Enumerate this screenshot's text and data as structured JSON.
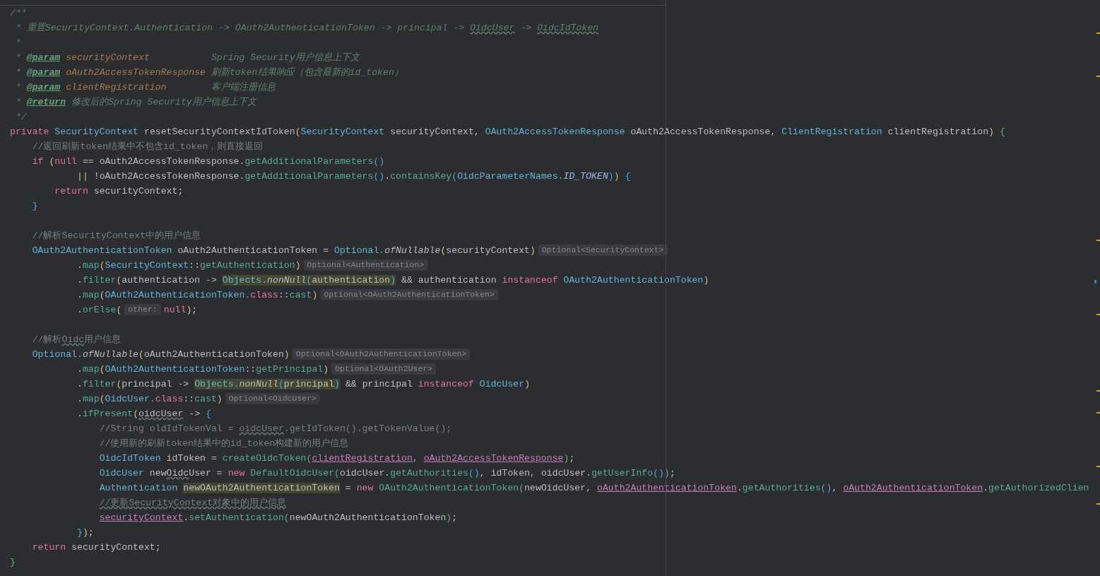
{
  "editor": {
    "blocks": [
      {
        "lines": [
          {
            "tokens": [
              {
                "text": "/**",
                "kind": "doc"
              }
            ]
          },
          {
            "tokens": [
              {
                "text": " * 重置SecurityContext.Authentication -> OAuth2AuthenticationToken -> principal -> ",
                "kind": "doc"
              },
              {
                "text": "OidcUser",
                "kind": "doc-typo"
              },
              {
                "text": " -> ",
                "kind": "doc"
              },
              {
                "text": "OidcIdToken",
                "kind": "doc-typo"
              }
            ]
          },
          {
            "tokens": [
              {
                "text": " *",
                "kind": "doc"
              }
            ]
          },
          {
            "tokens": [
              {
                "text": " * ",
                "kind": "doc"
              },
              {
                "text": "@param",
                "kind": "doc-tag"
              },
              {
                "text": " securityContext",
                "kind": "doc-param"
              },
              {
                "text": "           Spring Security用户信息上下文",
                "kind": "doc"
              }
            ]
          },
          {
            "tokens": [
              {
                "text": " * ",
                "kind": "doc"
              },
              {
                "text": "@param",
                "kind": "doc-tag"
              },
              {
                "text": " oAuth2AccessTokenResponse",
                "kind": "doc-param"
              },
              {
                "text": " 刷新token结果响应（包含最新的id_token）",
                "kind": "doc"
              }
            ]
          },
          {
            "tokens": [
              {
                "text": " * ",
                "kind": "doc"
              },
              {
                "text": "@param",
                "kind": "doc-tag"
              },
              {
                "text": " clientRegistration",
                "kind": "doc-param"
              },
              {
                "text": "        客户端注册信息",
                "kind": "doc"
              }
            ]
          },
          {
            "tokens": [
              {
                "text": " * ",
                "kind": "doc"
              },
              {
                "text": "@return",
                "kind": "doc-tag"
              },
              {
                "text": " 修改后的Spring Security用户信息上下文",
                "kind": "doc"
              }
            ]
          },
          {
            "tokens": [
              {
                "text": " */",
                "kind": "doc"
              }
            ]
          },
          {
            "tokens": [
              {
                "text": "private",
                "kind": "keyword"
              },
              {
                "text": " SecurityContext",
                "kind": "type"
              },
              {
                "text": " resetSecurityContextIdToken",
                "kind": "plain"
              },
              {
                "text": "(",
                "kind": "bracket-1"
              },
              {
                "text": "SecurityContext",
                "kind": "type"
              },
              {
                "text": " securityContext, ",
                "kind": "plain"
              },
              {
                "text": "OAuth2AccessTokenResponse",
                "kind": "type"
              },
              {
                "text": " oAuth2AccessTokenResponse, ",
                "kind": "plain"
              },
              {
                "text": "ClientRegistration",
                "kind": "type"
              },
              {
                "text": " clientRegistration",
                "kind": "plain"
              },
              {
                "text": ")",
                "kind": "bracket-1"
              },
              {
                "text": " {",
                "kind": "bracket-3"
              }
            ]
          },
          {
            "tokens": [
              {
                "text": "    //返回刷新token结果中不包含id_token，则直接返回",
                "kind": "comment"
              }
            ]
          },
          {
            "tokens": [
              {
                "text": "    if",
                "kind": "keyword"
              },
              {
                "text": " (",
                "kind": "bracket-1"
              },
              {
                "text": "null",
                "kind": "keyword"
              },
              {
                "text": " == oAuth2AccessTokenResponse.",
                "kind": "plain"
              },
              {
                "text": "getAdditionalParameters",
                "kind": "method"
              },
              {
                "text": "()",
                "kind": "bracket-2"
              }
            ]
          },
          {
            "tokens": [
              {
                "text": "            ||",
                "kind": "bracket-1"
              },
              {
                "text": " !oAuth2AccessTokenResponse.",
                "kind": "plain"
              },
              {
                "text": "getAdditionalParameters",
                "kind": "method"
              },
              {
                "text": "()",
                "kind": "bracket-2"
              },
              {
                "text": ".",
                "kind": "plain"
              },
              {
                "text": "containsKey",
                "kind": "method"
              },
              {
                "text": "(",
                "kind": "bracket-2"
              },
              {
                "text": "OidcParameterNames.",
                "kind": "type"
              },
              {
                "text": "ID_TOKEN",
                "kind": "constant"
              },
              {
                "text": ")",
                "kind": "bracket-2"
              },
              {
                "text": ")",
                "kind": "bracket-1"
              },
              {
                "text": " {",
                "kind": "bracket-2"
              }
            ]
          },
          {
            "tokens": [
              {
                "text": "        return",
                "kind": "keyword"
              },
              {
                "text": " securityContext;",
                "kind": "plain"
              }
            ]
          },
          {
            "tokens": [
              {
                "text": "    }",
                "kind": "bracket-2"
              }
            ]
          }
        ]
      },
      {
        "lines": [
          {
            "tokens": [
              {
                "text": "    //解析SecurityContext中的用户信息",
                "kind": "comment"
              }
            ]
          },
          {
            "tokens": [
              {
                "text": "    OAuth2AuthenticationToken",
                "kind": "type"
              },
              {
                "text": " oAuth2AuthenticationToken = ",
                "kind": "plain"
              },
              {
                "text": "Optional.",
                "kind": "type"
              },
              {
                "text": "ofNullable",
                "kind": "static"
              },
              {
                "text": "(",
                "kind": "bracket-1"
              },
              {
                "text": "securityContext",
                "kind": "plain"
              },
              {
                "text": ")",
                "kind": "bracket-1"
              },
              {
                "text": "Optional<SecurityContext>",
                "kind": "hint"
              }
            ]
          },
          {
            "tokens": [
              {
                "text": "            .",
                "kind": "plain"
              },
              {
                "text": "map",
                "kind": "method"
              },
              {
                "text": "(",
                "kind": "bracket-1"
              },
              {
                "text": "SecurityContext",
                "kind": "type"
              },
              {
                "text": "::",
                "kind": "plain"
              },
              {
                "text": "getAuthentication",
                "kind": "method"
              },
              {
                "text": ")",
                "kind": "bracket-1"
              },
              {
                "text": "Optional<Authentication>",
                "kind": "hint"
              }
            ]
          },
          {
            "tokens": [
              {
                "text": "            .",
                "kind": "plain"
              },
              {
                "text": "filter",
                "kind": "method"
              },
              {
                "text": "(",
                "kind": "bracket-1"
              },
              {
                "text": "authentication -> ",
                "kind": "plain"
              },
              {
                "kind": "highlight",
                "tokens": [
                  {
                    "text": "Objects.",
                    "kind": "type"
                  },
                  {
                    "text": "nonNull",
                    "kind": "static"
                  },
                  {
                    "text": "(",
                    "kind": "bracket-2"
                  },
                  {
                    "text": "authentication",
                    "kind": "plain"
                  },
                  {
                    "text": ")",
                    "kind": "bracket-2"
                  }
                ]
              },
              {
                "text": " && authentication ",
                "kind": "plain"
              },
              {
                "text": "instanceof",
                "kind": "keyword"
              },
              {
                "text": " OAuth2AuthenticationToken",
                "kind": "type"
              },
              {
                "text": ")",
                "kind": "bracket-1"
              }
            ]
          },
          {
            "tokens": [
              {
                "text": "            .",
                "kind": "plain"
              },
              {
                "text": "map",
                "kind": "method"
              },
              {
                "text": "(",
                "kind": "bracket-1"
              },
              {
                "text": "OAuth2AuthenticationToken.",
                "kind": "type"
              },
              {
                "text": "class",
                "kind": "keyword"
              },
              {
                "text": "::",
                "kind": "plain"
              },
              {
                "text": "cast",
                "kind": "method"
              },
              {
                "text": ")",
                "kind": "bracket-1"
              },
              {
                "text": "Optional<OAuth2AuthenticationToken>",
                "kind": "hint"
              }
            ]
          },
          {
            "tokens": [
              {
                "text": "            .",
                "kind": "plain"
              },
              {
                "text": "orElse",
                "kind": "method"
              },
              {
                "text": "(",
                "kind": "bracket-1"
              },
              {
                "text": "other:",
                "kind": "hint"
              },
              {
                "text": "null",
                "kind": "keyword"
              },
              {
                "text": ")",
                "kind": "bracket-1"
              },
              {
                "text": ";",
                "kind": "plain"
              }
            ]
          }
        ]
      },
      {
        "lines": [
          {
            "tokens": [
              {
                "text": "    //解析",
                "kind": "comment"
              },
              {
                "text": "Oidc",
                "kind": "comment-typo"
              },
              {
                "text": "用户信息",
                "kind": "comment"
              }
            ]
          },
          {
            "tokens": [
              {
                "text": "    Optional.",
                "kind": "type"
              },
              {
                "text": "ofNullable",
                "kind": "static"
              },
              {
                "text": "(",
                "kind": "bracket-1"
              },
              {
                "text": "oAuth2AuthenticationToken",
                "kind": "plain"
              },
              {
                "text": ")",
                "kind": "bracket-1"
              },
              {
                "text": "Optional<OAuth2AuthenticationToken>",
                "kind": "hint"
              }
            ]
          },
          {
            "tokens": [
              {
                "text": "            .",
                "kind": "plain"
              },
              {
                "text": "map",
                "kind": "method"
              },
              {
                "text": "(",
                "kind": "bracket-1"
              },
              {
                "text": "OAuth2AuthenticationToken",
                "kind": "type"
              },
              {
                "text": "::",
                "kind": "plain"
              },
              {
                "text": "getPrincipal",
                "kind": "method"
              },
              {
                "text": ")",
                "kind": "bracket-1"
              },
              {
                "text": "Optional<OAuth2User>",
                "kind": "hint"
              }
            ]
          },
          {
            "tokens": [
              {
                "text": "            .",
                "kind": "plain"
              },
              {
                "text": "filter",
                "kind": "method"
              },
              {
                "text": "(",
                "kind": "bracket-1"
              },
              {
                "text": "principal -> ",
                "kind": "plain"
              },
              {
                "kind": "highlight",
                "tokens": [
                  {
                    "text": "Objects.",
                    "kind": "type"
                  },
                  {
                    "text": "nonNull",
                    "kind": "static"
                  },
                  {
                    "text": "(",
                    "kind": "bracket-2"
                  },
                  {
                    "text": "principal",
                    "kind": "plain"
                  },
                  {
                    "text": ")",
                    "kind": "bracket-2"
                  }
                ]
              },
              {
                "text": " && principal ",
                "kind": "plain"
              },
              {
                "text": "instanceof",
                "kind": "keyword"
              },
              {
                "text": " OidcUser",
                "kind": "type"
              },
              {
                "text": ")",
                "kind": "bracket-1"
              }
            ]
          },
          {
            "tokens": [
              {
                "text": "            .",
                "kind": "plain"
              },
              {
                "text": "map",
                "kind": "method"
              },
              {
                "text": "(",
                "kind": "bracket-1"
              },
              {
                "text": "OidcUser.",
                "kind": "type"
              },
              {
                "text": "class",
                "kind": "keyword"
              },
              {
                "text": "::",
                "kind": "plain"
              },
              {
                "text": "cast",
                "kind": "method"
              },
              {
                "text": ")",
                "kind": "bracket-1"
              },
              {
                "text": "Optional<OidcUser>",
                "kind": "hint"
              }
            ]
          },
          {
            "tokens": [
              {
                "text": "            .",
                "kind": "plain"
              },
              {
                "text": "ifPresent",
                "kind": "method"
              },
              {
                "text": "(",
                "kind": "bracket-1"
              },
              {
                "text": "oidcUser",
                "kind": "typo"
              },
              {
                "text": " -> ",
                "kind": "plain"
              },
              {
                "text": "{",
                "kind": "bracket-2"
              }
            ]
          },
          {
            "tokens": [
              {
                "text": "                //String oldIdTokenVal = ",
                "kind": "comment"
              },
              {
                "text": "oidcUser",
                "kind": "comment-typo"
              },
              {
                "text": ".getIdToken().getTokenValue();",
                "kind": "comment"
              }
            ]
          },
          {
            "tokens": [
              {
                "text": "                //使用新的刷新token结果中的id_token构建新的用户信息",
                "kind": "comment"
              }
            ]
          },
          {
            "tokens": [
              {
                "text": "                OidcIdToken",
                "kind": "type"
              },
              {
                "text": " idToken = ",
                "kind": "plain"
              },
              {
                "text": "createOidcToken",
                "kind": "method"
              },
              {
                "text": "(",
                "kind": "bracket-3"
              },
              {
                "text": "clientRegistration",
                "kind": "captured"
              },
              {
                "text": ", ",
                "kind": "plain"
              },
              {
                "text": "oAuth2AccessTokenResponse",
                "kind": "captured"
              },
              {
                "text": ")",
                "kind": "bracket-3"
              },
              {
                "text": ";",
                "kind": "plain"
              }
            ]
          },
          {
            "tokens": [
              {
                "text": "                OidcUser",
                "kind": "type"
              },
              {
                "text": " new",
                "kind": "plain"
              },
              {
                "text": "Oidc",
                "kind": "typo"
              },
              {
                "text": "User = ",
                "kind": "plain"
              },
              {
                "text": "new",
                "kind": "keyword"
              },
              {
                "text": " DefaultOidcUser",
                "kind": "method"
              },
              {
                "text": "(",
                "kind": "bracket-3"
              },
              {
                "text": "oidcUser.",
                "kind": "plain"
              },
              {
                "text": "getAuthorities",
                "kind": "method"
              },
              {
                "text": "()",
                "kind": "bracket-2"
              },
              {
                "text": ", idToken, oidcUser.",
                "kind": "plain"
              },
              {
                "text": "getUserInfo",
                "kind": "method"
              },
              {
                "text": "()",
                "kind": "bracket-2"
              },
              {
                "text": ")",
                "kind": "bracket-3"
              },
              {
                "text": ";",
                "kind": "plain"
              }
            ]
          },
          {
            "tokens": [
              {
                "text": "                Authentication ",
                "kind": "type"
              },
              {
                "kind": "highlight",
                "tokens": [
                  {
                    "text": "newOAuth2AuthenticationToken",
                    "kind": "plain"
                  }
                ]
              },
              {
                "text": " = ",
                "kind": "plain"
              },
              {
                "text": "new",
                "kind": "keyword"
              },
              {
                "text": " OAuth2AuthenticationToken",
                "kind": "method"
              },
              {
                "text": "(",
                "kind": "bracket-3"
              },
              {
                "text": "newOidcUser, ",
                "kind": "plain"
              },
              {
                "text": "oAuth2AuthenticationToken",
                "kind": "captured"
              },
              {
                "text": ".",
                "kind": "plain"
              },
              {
                "text": "getAuthorities",
                "kind": "method"
              },
              {
                "text": "()",
                "kind": "bracket-2"
              },
              {
                "text": ", ",
                "kind": "plain"
              },
              {
                "text": "oAuth2AuthenticationToken",
                "kind": "captured"
              },
              {
                "text": ".",
                "kind": "plain"
              },
              {
                "text": "getAuthorizedClien",
                "kind": "method"
              }
            ]
          },
          {
            "tokens": [
              {
                "text": "                //更新SecurityContext对象中的用户信息",
                "kind": "comment-typo"
              }
            ]
          },
          {
            "tokens": [
              {
                "text": "                securityContext",
                "kind": "captured"
              },
              {
                "text": ".",
                "kind": "plain"
              },
              {
                "text": "setAuthentication",
                "kind": "method"
              },
              {
                "text": "(",
                "kind": "bracket-3"
              },
              {
                "text": "newOAuth2AuthenticationToken",
                "kind": "plain"
              },
              {
                "text": ")",
                "kind": "bracket-3"
              },
              {
                "text": ";",
                "kind": "plain"
              }
            ]
          },
          {
            "tokens": [
              {
                "text": "            }",
                "kind": "bracket-2"
              },
              {
                "text": ")",
                "kind": "bracket-1"
              },
              {
                "text": ";",
                "kind": "plain"
              }
            ]
          },
          {
            "tokens": [
              {
                "text": "    return",
                "kind": "keyword"
              },
              {
                "text": " securityContext;",
                "kind": "plain"
              }
            ]
          },
          {
            "tokens": [
              {
                "text": "}",
                "kind": "bracket-3"
              }
            ]
          }
        ]
      }
    ]
  }
}
